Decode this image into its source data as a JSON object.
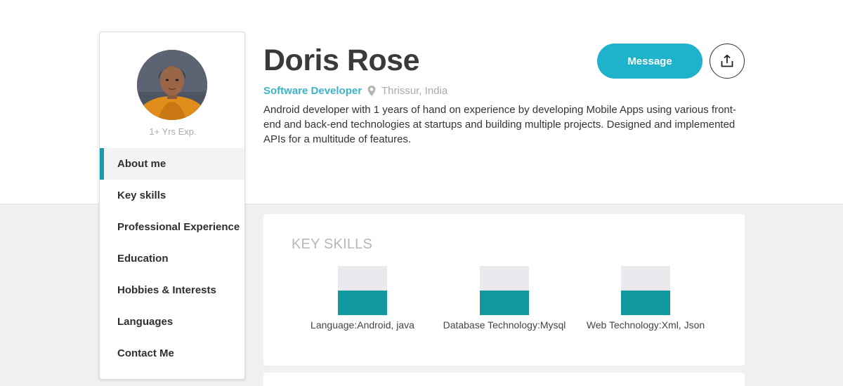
{
  "profile": {
    "name": "Doris Rose",
    "role": "Software Developer",
    "location": "Thrissur, India",
    "experience": "1+ Yrs Exp.",
    "bio": "Android developer with 1 years of hand on experience by developing Mobile Apps using various front-end and back-end technologies at startups and building multiple projects. Designed and implemented APIs for a multitude of features."
  },
  "actions": {
    "message_label": "Message",
    "share_icon": "share-upload-icon"
  },
  "nav": {
    "items": [
      {
        "label": "About me",
        "active": true
      },
      {
        "label": "Key skills",
        "active": false
      },
      {
        "label": "Professional Experience",
        "active": false
      },
      {
        "label": "Education",
        "active": false
      },
      {
        "label": "Hobbies & Interests",
        "active": false
      },
      {
        "label": "Languages",
        "active": false
      },
      {
        "label": "Contact Me",
        "active": false
      }
    ]
  },
  "skills": {
    "title": "KEY SKILLS",
    "items": [
      {
        "label": "Language:Android, java",
        "level": 0.5
      },
      {
        "label": "Database Technology:Mysql",
        "level": 0.5
      },
      {
        "label": "Web Technology:Xml, Json",
        "level": 0.5
      }
    ]
  },
  "colors": {
    "accent": "#1eb3cb",
    "skill_fill": "#12999f",
    "active_marker": "#1a9aaa"
  }
}
